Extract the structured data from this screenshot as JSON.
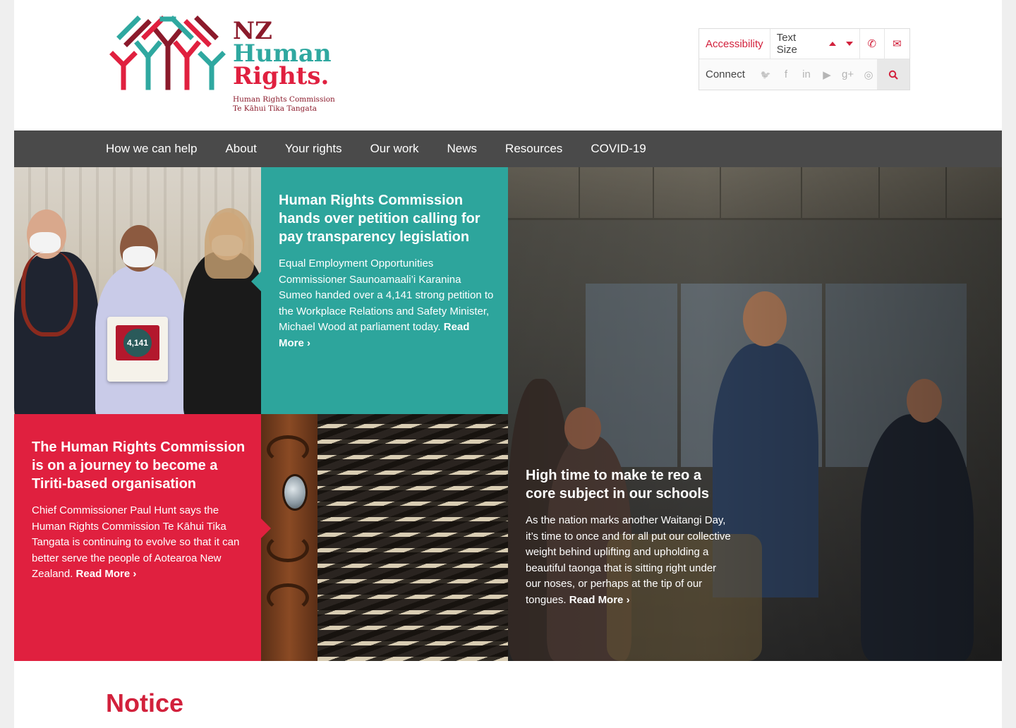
{
  "colors": {
    "brand_red": "#e0203f",
    "brand_teal": "#2da59c",
    "brand_maroon": "#8b1a2b",
    "nav_bg": "#4a4a4a"
  },
  "logo": {
    "line1": "NZ",
    "line2": "Human",
    "line3": "Rights.",
    "sub1": "Human Rights Commission",
    "sub2": "Te Kāhui Tika Tangata"
  },
  "utility": {
    "accessibility": "Accessibility",
    "text_size": "Text Size",
    "connect": "Connect",
    "icons": [
      "arrow-up-icon",
      "arrow-down-icon",
      "phone-icon",
      "envelope-icon"
    ],
    "social": [
      "twitter-icon",
      "facebook-icon",
      "linkedin-icon",
      "youtube-icon",
      "google-plus-icon",
      "instagram-icon"
    ],
    "search_icon": "search-icon",
    "glyphs": {
      "phone": "✆",
      "envelope": "✉",
      "twitter": "🐦",
      "facebook": "f",
      "linkedin": "in",
      "youtube": "▶",
      "googleplus": "g+",
      "instagram": "◎",
      "search": "⚲"
    }
  },
  "nav": {
    "items": [
      "How we can help",
      "About",
      "Your rights",
      "Our work",
      "News",
      "Resources",
      "COVID-19"
    ]
  },
  "stories": {
    "teal": {
      "title": "Human Rights Commission hands over petition calling for pay transparency legislation",
      "body": "Equal Employment Opportunities Commissioner Saunoamaali’i Karanina Sumeo handed over a 4,141 strong petition to the Workplace Relations and Safety Minister, Michael Wood at parliament today. ",
      "read_more": "Read More ›"
    },
    "red": {
      "title": "The Human Rights Commission is on a journey to become a Tiriti-based organisation",
      "body": "Chief Commissioner Paul Hunt says the Human Rights Commission Te Kāhui Tika Tangata is continuing to evolve so that it can better serve the people of Aotearoa New Zealand. ",
      "read_more": "Read More ›"
    },
    "big": {
      "title": "High time to make te reo a core subject in our schools",
      "body": "As the nation marks another Waitangi Day, it’s time to once and for all put our collective weight behind uplifting and upholding a beautiful taonga that is sitting right under our noses, or perhaps at the tip of our tongues. ",
      "read_more": "Read More ›"
    },
    "petition_box_number": "4,141"
  },
  "notice": {
    "heading": "Notice"
  }
}
